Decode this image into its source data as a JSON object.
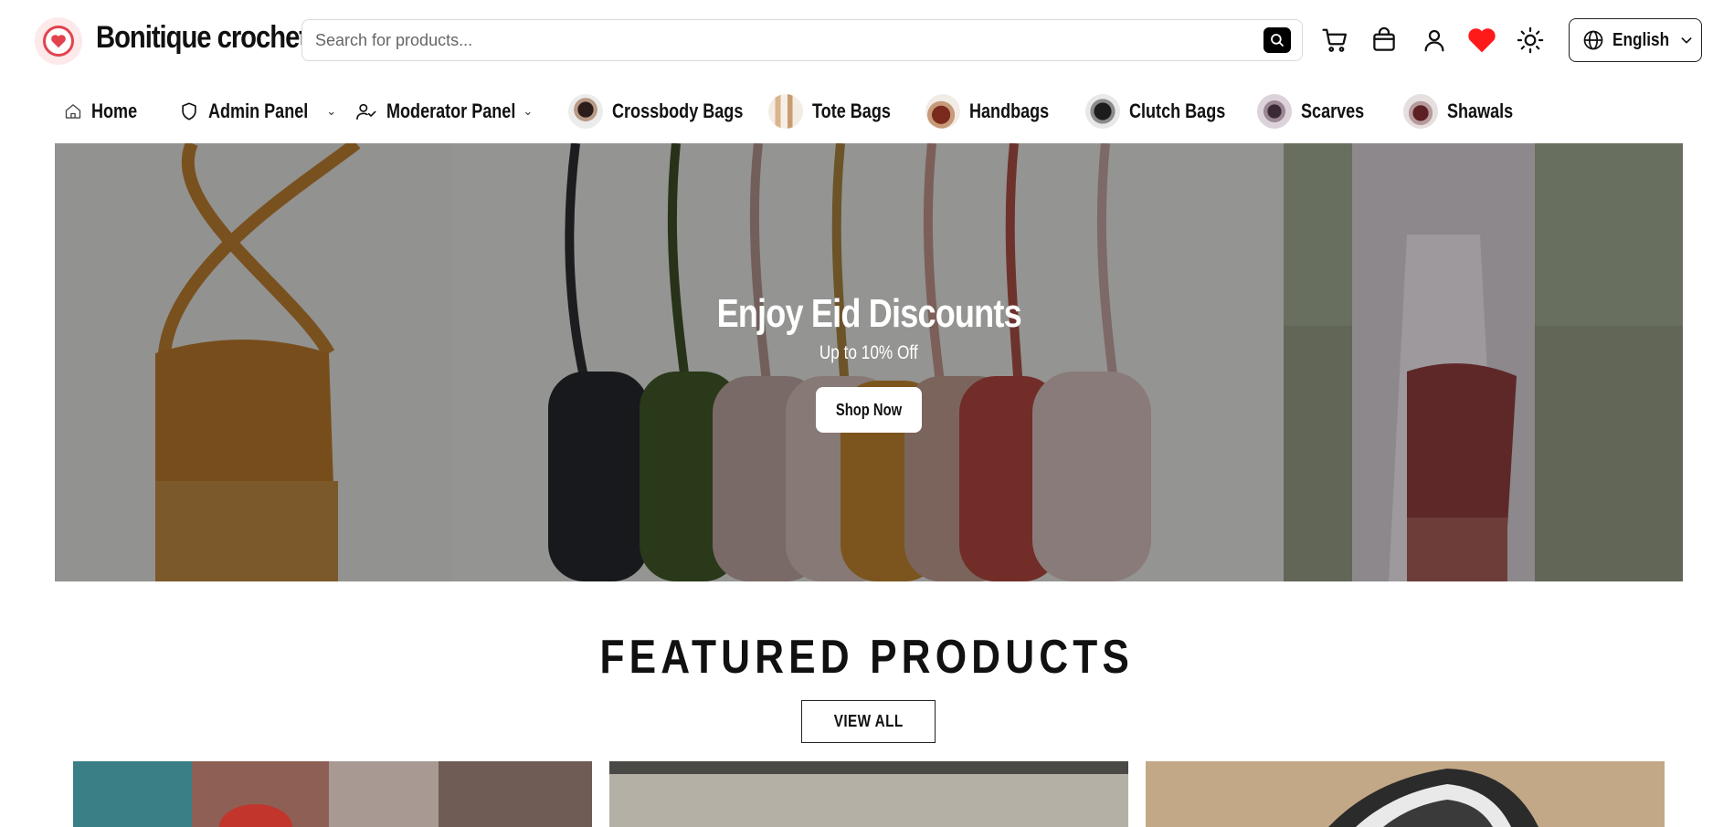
{
  "header": {
    "brand": "Bonitique crochet",
    "search_placeholder": "Search for products...",
    "language": "English",
    "brand_color": "#e2434f"
  },
  "icons": {
    "cart": "cart-icon",
    "orders": "shopping-bag-icon",
    "account": "user-icon",
    "wishlist": "heart-icon",
    "theme": "sun-icon",
    "language": "globe-icon"
  },
  "nav": {
    "home": "Home",
    "admin": "Admin Panel",
    "moderator": "Moderator Panel",
    "crossbody": "Crossbody Bags",
    "tote": "Tote Bags",
    "handbags": "Handbags",
    "clutch": "Clutch Bags",
    "scarves": "Scarves",
    "shawals": "Shawals"
  },
  "hero": {
    "title": "Enjoy Eid Discounts",
    "subtitle": "Up to 10% Off",
    "cta": "Shop Now"
  },
  "featured": {
    "title": "FEATURED PRODUCTS",
    "view_all": "VIEW ALL"
  }
}
